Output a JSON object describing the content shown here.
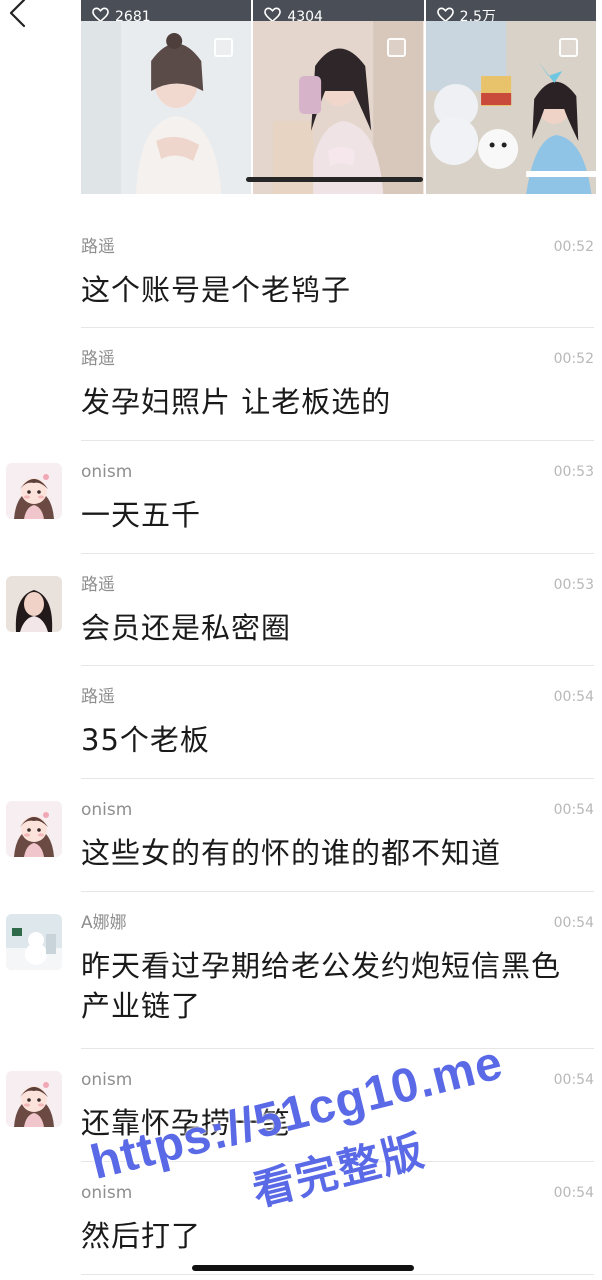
{
  "header": {
    "back_icon": "chevron-left-icon"
  },
  "gallery": {
    "items": [
      {
        "likes": "2681",
        "icon": "heart-outline-icon"
      },
      {
        "likes": "4304",
        "icon": "heart-outline-icon"
      },
      {
        "likes": "2.5万",
        "icon": "heart-outline-icon"
      }
    ]
  },
  "messages": [
    {
      "name": "路遥",
      "time": "00:52",
      "text": "这个账号是个老鸨子",
      "avatar": false
    },
    {
      "name": "路遥",
      "time": "00:52",
      "text": "发孕妇照片 让老板选的",
      "avatar": false
    },
    {
      "name": "onism",
      "time": "00:53",
      "text": "一天五千",
      "avatar": true
    },
    {
      "name": "路遥",
      "time": "00:53",
      "text": "会员还是私密圈",
      "avatar": true
    },
    {
      "name": "路遥",
      "time": "00:54",
      "text": "35个老板",
      "avatar": false
    },
    {
      "name": "onism",
      "time": "00:54",
      "text": "这些女的有的怀的谁的都不知道",
      "avatar": true
    },
    {
      "name": "A娜娜",
      "time": "00:54",
      "text": "昨天看过孕期给老公发约炮短信黑色产业链了",
      "avatar": true
    },
    {
      "name": "onism",
      "time": "00:54",
      "text": "还靠怀孕捞一笔",
      "avatar": true
    },
    {
      "name": "onism",
      "time": "00:54",
      "text": "然后打了",
      "avatar": false
    }
  ],
  "watermark": {
    "url": "https://51cg10.me",
    "caption": "看完整版"
  }
}
